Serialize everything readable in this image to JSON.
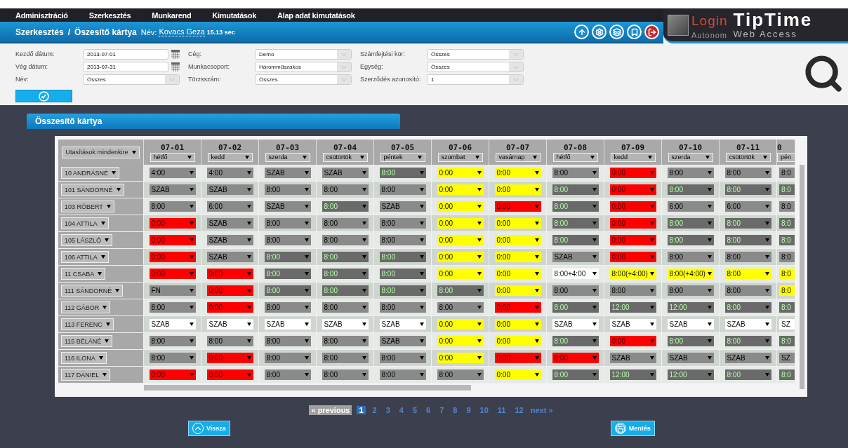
{
  "menu": [
    "Adminisztráció",
    "Szerkesztés",
    "Munkarend",
    "Kimutatások",
    "Alap adat kimutatások"
  ],
  "breadcrumb": {
    "section": "Szerkesztés",
    "separator": "/",
    "page": "Öszesítő kártya",
    "name_label": "Név:",
    "name": "Kovacs Geza",
    "time": "15.13 sec"
  },
  "logo": {
    "login": "Login",
    "product": "TipTime",
    "subtitle": "Autonom",
    "tagline": "Web Access"
  },
  "filter_columns": [
    [
      {
        "label": "Kezdő dátum:",
        "value": "2013-07-01",
        "kind": "date"
      },
      {
        "label": "Vég dátum:",
        "value": "2013-07-31",
        "kind": "date"
      },
      {
        "label": "Név:",
        "value": "Összes",
        "kind": "select"
      }
    ],
    [
      {
        "label": "Cég:",
        "value": "Demo",
        "kind": "select"
      },
      {
        "label": "Munkacsoport:",
        "value": "Háromműszakos",
        "kind": "select"
      },
      {
        "label": "Törzsszám:",
        "value": "Összes",
        "kind": "select"
      }
    ],
    [
      {
        "label": "Számfejtési kör:",
        "value": "Összes",
        "kind": "select"
      },
      {
        "label": "Egység:",
        "value": "Összes",
        "kind": "select"
      },
      {
        "label": "Szerződés azonosító:",
        "value": "1",
        "kind": "select"
      }
    ]
  ],
  "panel_title": "Összesítő kártya",
  "table": {
    "corner": "Utasítások mindenkire",
    "columns": [
      {
        "date": "07-01",
        "day": "hétfő"
      },
      {
        "date": "07-02",
        "day": "kedd"
      },
      {
        "date": "07-03",
        "day": "szerda"
      },
      {
        "date": "07-04",
        "day": "csütörtök"
      },
      {
        "date": "07-05",
        "day": "péntek"
      },
      {
        "date": "07-06",
        "day": "szombat"
      },
      {
        "date": "07-07",
        "day": "vasárnap"
      },
      {
        "date": "07-08",
        "day": "hétfő"
      },
      {
        "date": "07-09",
        "day": "kedd"
      },
      {
        "date": "07-10",
        "day": "szerda"
      },
      {
        "date": "07-11",
        "day": "csütörtök"
      },
      {
        "date": "0",
        "day": "pén"
      }
    ],
    "rows": [
      {
        "name": "10 ANDRÁSNÉ",
        "cells": [
          {
            "value": "4:00",
            "kind": "gray"
          },
          {
            "value": "4:00",
            "kind": "gray"
          },
          {
            "value": "SZAB",
            "kind": "gray"
          },
          {
            "value": "SZAB",
            "kind": "gray"
          },
          {
            "value": "8:00",
            "kind": "green"
          },
          {
            "value": "0:00",
            "kind": "yellow"
          },
          {
            "value": "0:00",
            "kind": "yellow"
          },
          {
            "value": "8:00",
            "kind": "gray"
          },
          {
            "value": "0:00",
            "kind": "red"
          },
          {
            "value": "8:00",
            "kind": "gray"
          },
          {
            "value": "8:00",
            "kind": "gray"
          },
          {
            "value": "8:0",
            "kind": "gray"
          }
        ]
      },
      {
        "name": "101 SÁNDORNÉ",
        "cells": [
          {
            "value": "SZAB",
            "kind": "gray"
          },
          {
            "value": "SZAB",
            "kind": "gray"
          },
          {
            "value": "8:00",
            "kind": "gray"
          },
          {
            "value": "8:00",
            "kind": "gray"
          },
          {
            "value": "8:00",
            "kind": "gray"
          },
          {
            "value": "0:00",
            "kind": "yellow"
          },
          {
            "value": "0:00",
            "kind": "yellow"
          },
          {
            "value": "8:00",
            "kind": "green"
          },
          {
            "value": "0:00",
            "kind": "red"
          },
          {
            "value": "8:00",
            "kind": "green"
          },
          {
            "value": "8:00",
            "kind": "green"
          },
          {
            "value": "8:0",
            "kind": "green"
          }
        ]
      },
      {
        "name": "103 RÓBERT",
        "cells": [
          {
            "value": "8:00",
            "kind": "gray"
          },
          {
            "value": "6:00",
            "kind": "gray"
          },
          {
            "value": "SZAB",
            "kind": "gray"
          },
          {
            "value": "8:00",
            "kind": "green"
          },
          {
            "value": "SZAB",
            "kind": "gray"
          },
          {
            "value": "0:00",
            "kind": "yellow"
          },
          {
            "value": "0:00",
            "kind": "red"
          },
          {
            "value": "8:00",
            "kind": "green"
          },
          {
            "value": "0:00",
            "kind": "red"
          },
          {
            "value": "6:00",
            "kind": "gray"
          },
          {
            "value": "6:00",
            "kind": "gray"
          },
          {
            "value": "8:0",
            "kind": "gray"
          }
        ]
      },
      {
        "name": "104 ATTILA",
        "cells": [
          {
            "value": "0:00",
            "kind": "red"
          },
          {
            "value": "SZAB",
            "kind": "gray"
          },
          {
            "value": "8:00",
            "kind": "gray"
          },
          {
            "value": "8:00",
            "kind": "gray"
          },
          {
            "value": "8:00",
            "kind": "gray"
          },
          {
            "value": "0:00",
            "kind": "yellow"
          },
          {
            "value": "0:00",
            "kind": "yellow"
          },
          {
            "value": "8:00",
            "kind": "green"
          },
          {
            "value": "0:00",
            "kind": "red"
          },
          {
            "value": "8:00",
            "kind": "green"
          },
          {
            "value": "8:00",
            "kind": "green"
          },
          {
            "value": "8:0",
            "kind": "green"
          }
        ]
      },
      {
        "name": "105 LÁSZLÓ",
        "cells": [
          {
            "value": "0:00",
            "kind": "red"
          },
          {
            "value": "SZAB",
            "kind": "gray"
          },
          {
            "value": "8:00",
            "kind": "gray"
          },
          {
            "value": "8:00",
            "kind": "gray"
          },
          {
            "value": "8:00",
            "kind": "gray"
          },
          {
            "value": "0:00",
            "kind": "yellow"
          },
          {
            "value": "0:00",
            "kind": "yellow"
          },
          {
            "value": "8:00",
            "kind": "green"
          },
          {
            "value": "0:00",
            "kind": "red"
          },
          {
            "value": "8:00",
            "kind": "green"
          },
          {
            "value": "8:00",
            "kind": "green"
          },
          {
            "value": "8:0",
            "kind": "green"
          }
        ]
      },
      {
        "name": "106 ATTILA",
        "cells": [
          {
            "value": "0:00",
            "kind": "red"
          },
          {
            "value": "SZAB",
            "kind": "gray"
          },
          {
            "value": "8:00",
            "kind": "green"
          },
          {
            "value": "8:00",
            "kind": "green"
          },
          {
            "value": "8:00",
            "kind": "green"
          },
          {
            "value": "0:00",
            "kind": "yellow"
          },
          {
            "value": "0:00",
            "kind": "yellow"
          },
          {
            "value": "SZAB",
            "kind": "gray"
          },
          {
            "value": "0:00",
            "kind": "red"
          },
          {
            "value": "8:00",
            "kind": "gray"
          },
          {
            "value": "8:00",
            "kind": "gray"
          },
          {
            "value": "8:0",
            "kind": "gray"
          }
        ]
      },
      {
        "name": "11 CSABA",
        "cells": [
          {
            "value": "0:00",
            "kind": "red"
          },
          {
            "value": "0:00",
            "kind": "red"
          },
          {
            "value": "8:00",
            "kind": "green"
          },
          {
            "value": "8:00",
            "kind": "green"
          },
          {
            "value": "8:00",
            "kind": "green"
          },
          {
            "value": "0:00",
            "kind": "yellow"
          },
          {
            "value": "0:00",
            "kind": "yellow"
          },
          {
            "value": "8:00+4:00",
            "kind": "white"
          },
          {
            "value": "8:00(+4:00)",
            "kind": "yellow"
          },
          {
            "value": "8:00(+4:00)",
            "kind": "yellow"
          },
          {
            "value": "8:00",
            "kind": "yellow"
          },
          {
            "value": "8:0",
            "kind": "yellow"
          }
        ]
      },
      {
        "name": "111 SÁNDORNÉ",
        "cells": [
          {
            "value": "FN",
            "kind": "gray"
          },
          {
            "value": "0:00",
            "kind": "red"
          },
          {
            "value": "8:00",
            "kind": "green"
          },
          {
            "value": "8:00",
            "kind": "green"
          },
          {
            "value": "8:00",
            "kind": "green"
          },
          {
            "value": "8:00",
            "kind": "green"
          },
          {
            "value": "0:00",
            "kind": "yellow"
          },
          {
            "value": "8:00",
            "kind": "gray"
          },
          {
            "value": "8:00",
            "kind": "gray"
          },
          {
            "value": "8:00",
            "kind": "gray"
          },
          {
            "value": "8:00",
            "kind": "gray"
          },
          {
            "value": "8:0",
            "kind": "yellow"
          }
        ]
      },
      {
        "name": "112 GÁBOR",
        "cells": [
          {
            "value": "8:00",
            "kind": "gray"
          },
          {
            "value": "0:00",
            "kind": "red"
          },
          {
            "value": "8:00",
            "kind": "gray"
          },
          {
            "value": "8:00",
            "kind": "gray"
          },
          {
            "value": "8:00",
            "kind": "gray"
          },
          {
            "value": "8:00",
            "kind": "gray"
          },
          {
            "value": "0:00",
            "kind": "red"
          },
          {
            "value": "8:00",
            "kind": "green"
          },
          {
            "value": "12:00",
            "kind": "green"
          },
          {
            "value": "12:00",
            "kind": "green"
          },
          {
            "value": "8:00",
            "kind": "green"
          },
          {
            "value": "8:0",
            "kind": "green"
          }
        ]
      },
      {
        "name": "113 FERENC",
        "cells": [
          {
            "value": "SZAB",
            "kind": "white"
          },
          {
            "value": "SZAB",
            "kind": "white"
          },
          {
            "value": "SZAB",
            "kind": "white"
          },
          {
            "value": "SZAB",
            "kind": "white"
          },
          {
            "value": "SZAB",
            "kind": "white"
          },
          {
            "value": "0:00",
            "kind": "yellow"
          },
          {
            "value": "0:00",
            "kind": "yellow"
          },
          {
            "value": "SZAB",
            "kind": "white"
          },
          {
            "value": "SZAB",
            "kind": "white"
          },
          {
            "value": "SZAB",
            "kind": "white"
          },
          {
            "value": "SZAB",
            "kind": "white"
          },
          {
            "value": "SZ",
            "kind": "white"
          }
        ]
      },
      {
        "name": "115 BÉLÁNÉ",
        "cells": [
          {
            "value": "8:00",
            "kind": "gray"
          },
          {
            "value": "8:00",
            "kind": "gray"
          },
          {
            "value": "8:00",
            "kind": "gray"
          },
          {
            "value": "8:00",
            "kind": "gray"
          },
          {
            "value": "SZAB",
            "kind": "gray"
          },
          {
            "value": "0:00",
            "kind": "yellow"
          },
          {
            "value": "0:00",
            "kind": "yellow"
          },
          {
            "value": "8:00",
            "kind": "green"
          },
          {
            "value": "0:00",
            "kind": "red"
          },
          {
            "value": "8:00",
            "kind": "green"
          },
          {
            "value": "8:00",
            "kind": "green"
          },
          {
            "value": "8:0",
            "kind": "green"
          }
        ]
      },
      {
        "name": "116 ILONA",
        "cells": [
          {
            "value": "8:00",
            "kind": "gray"
          },
          {
            "value": "0:00",
            "kind": "red"
          },
          {
            "value": "8:00",
            "kind": "gray"
          },
          {
            "value": "8:00",
            "kind": "gray"
          },
          {
            "value": "8:00",
            "kind": "gray"
          },
          {
            "value": "0:00",
            "kind": "yellow"
          },
          {
            "value": "0:00",
            "kind": "red"
          },
          {
            "value": "0:00",
            "kind": "red"
          },
          {
            "value": "SZAB",
            "kind": "gray"
          },
          {
            "value": "SZAB",
            "kind": "gray"
          },
          {
            "value": "SZAB",
            "kind": "gray"
          },
          {
            "value": "SZ",
            "kind": "gray"
          }
        ]
      },
      {
        "name": "117 DÁNIEL",
        "cells": [
          {
            "value": "0:00",
            "kind": "red"
          },
          {
            "value": "0:00",
            "kind": "red"
          },
          {
            "value": "8:00",
            "kind": "gray"
          },
          {
            "value": "8:00",
            "kind": "gray"
          },
          {
            "value": "8:00",
            "kind": "gray"
          },
          {
            "value": "8:00",
            "kind": "gray"
          },
          {
            "value": "0:00",
            "kind": "yellow"
          },
          {
            "value": "8:00",
            "kind": "green"
          },
          {
            "value": "12:00",
            "kind": "green"
          },
          {
            "value": "12:00",
            "kind": "green"
          },
          {
            "value": "8:00",
            "kind": "green"
          },
          {
            "value": "8:0",
            "kind": "green"
          }
        ]
      }
    ]
  },
  "pagination": {
    "previous": "« previous",
    "pages": [
      {
        "label": "1",
        "selected": true
      },
      {
        "label": "2",
        "selected": false
      },
      {
        "label": "3",
        "selected": false
      },
      {
        "label": "4",
        "selected": false
      },
      {
        "label": "5",
        "selected": false
      },
      {
        "label": "6",
        "selected": false
      },
      {
        "label": "7",
        "selected": false
      },
      {
        "label": "8",
        "selected": false
      },
      {
        "label": "9",
        "selected": false
      },
      {
        "label": "10",
        "selected": false
      },
      {
        "label": "11",
        "selected": false
      },
      {
        "label": "12",
        "selected": false
      }
    ],
    "next": "next »"
  },
  "buttons": {
    "back": "Vissza",
    "save": "Mentés"
  }
}
